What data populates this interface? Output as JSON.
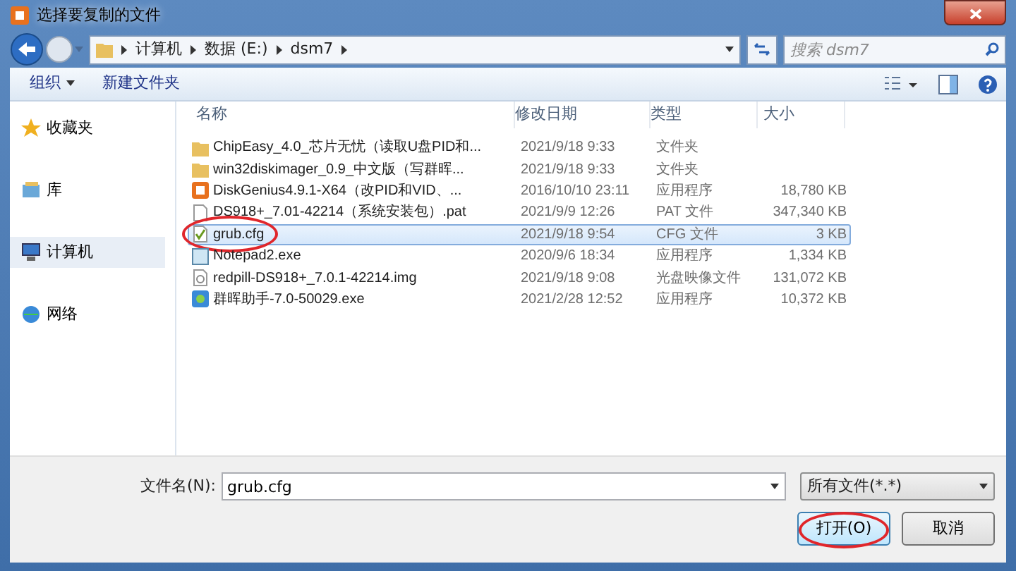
{
  "window": {
    "title": "选择要复制的文件"
  },
  "breadcrumb": [
    "计算机",
    "数据 (E:)",
    "dsm7"
  ],
  "search": {
    "placeholder": "搜索 dsm7"
  },
  "toolbar": [
    {
      "label": "组织",
      "dropdown": true
    },
    {
      "label": "新建文件夹",
      "dropdown": false
    }
  ],
  "sidebar": {
    "items": [
      {
        "label": "收藏夹",
        "selected": false
      },
      {
        "label": "库",
        "selected": false
      },
      {
        "label": "计算机",
        "selected": true
      },
      {
        "label": "网络",
        "selected": false
      }
    ]
  },
  "table": {
    "columns": [
      "名称",
      "修改日期",
      "类型",
      "大小"
    ],
    "rows": [
      {
        "name": "ChipEasy_4.0_芯片无忧（读取U盘PID和...",
        "date": "2021/9/18 9:33",
        "type": "文件夹",
        "size": "",
        "kind": "folder",
        "selected": false,
        "highlighted": false
      },
      {
        "name": "win32diskimager_0.9_中文版（写群晖...",
        "date": "2021/9/18 9:33",
        "type": "文件夹",
        "size": "",
        "kind": "folder",
        "selected": false,
        "highlighted": false
      },
      {
        "name": "DiskGenius4.9.1-X64（改PID和VID、...",
        "date": "2016/10/10 23:11",
        "type": "应用程序",
        "size": "18,780 KB",
        "kind": "app",
        "selected": false,
        "highlighted": false
      },
      {
        "name": "DS918+_7.01-42214（系统安装包）.pat",
        "date": "2021/9/9 12:26",
        "type": "PAT 文件",
        "size": "347,340 KB",
        "kind": "file",
        "selected": false,
        "highlighted": false
      },
      {
        "name": "grub.cfg",
        "date": "2021/9/18 9:54",
        "type": "CFG 文件",
        "size": "3 KB",
        "kind": "cfg",
        "selected": true,
        "highlighted": true
      },
      {
        "name": "Notepad2.exe",
        "date": "2020/9/6 18:34",
        "type": "应用程序",
        "size": "1,334 KB",
        "kind": "notepad",
        "selected": false,
        "highlighted": false
      },
      {
        "name": "redpill-DS918+_7.0.1-42214.img",
        "date": "2021/9/18 9:08",
        "type": "光盘映像文件",
        "size": "131,072 KB",
        "kind": "image",
        "selected": false,
        "highlighted": false
      },
      {
        "name": "群晖助手-7.0-50029.exe",
        "date": "2021/2/28 12:52",
        "type": "应用程序",
        "size": "10,372 KB",
        "kind": "exe",
        "selected": false,
        "highlighted": false
      }
    ]
  },
  "footer": {
    "filename_label": "文件名(N):",
    "filename": "grub.cfg",
    "filter": "所有文件(*.*)",
    "buttons": [
      {
        "label": "打开(O)",
        "highlighted": true
      },
      {
        "label": "取消",
        "highlighted": false
      }
    ]
  }
}
